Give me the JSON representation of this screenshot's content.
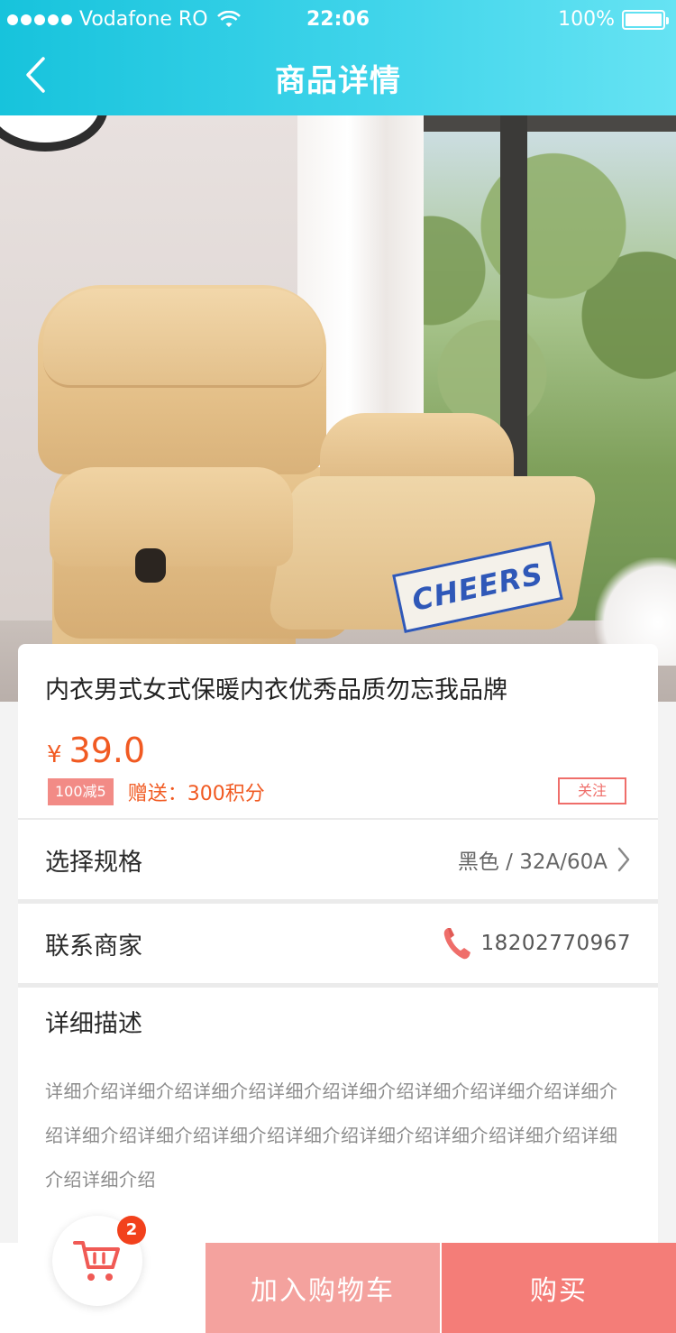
{
  "status_bar": {
    "carrier": "Vodafone RO",
    "time": "22:06",
    "battery": "100%"
  },
  "nav": {
    "title": "商品详情",
    "back_icon": "chevron-left-icon"
  },
  "product_image": {
    "logo_text": "CHEERS"
  },
  "product": {
    "title": "内衣男式女式保暖内衣优秀品质勿忘我品牌",
    "currency": "¥",
    "price": "39.0",
    "promo_badge": "100减5",
    "gift": "赠送：300积分",
    "follow_label": "关注"
  },
  "spec": {
    "label": "选择规格",
    "value": "黑色 / 32A/60A"
  },
  "contact": {
    "label": "联系商家",
    "phone": "18202770967"
  },
  "description": {
    "title": "详细描述",
    "text": "详细介绍详细介绍详细介绍详细介绍详细介绍详细介绍详细介绍详细介绍详细介绍详细介绍详细介绍详细介绍详细介绍详细介绍详细介绍详细介绍详细介绍"
  },
  "bottom_bar": {
    "cart_count": "2",
    "add_to_cart_label": "加入购物车",
    "buy_label": "购买"
  },
  "colors": {
    "header_gradient_start": "#17c3dc",
    "header_gradient_end": "#66e3f3",
    "price": "#f15a22",
    "accent_pink": "#f47d78",
    "accent_light_pink": "#f4a29e",
    "badge_red": "#f2411c"
  }
}
